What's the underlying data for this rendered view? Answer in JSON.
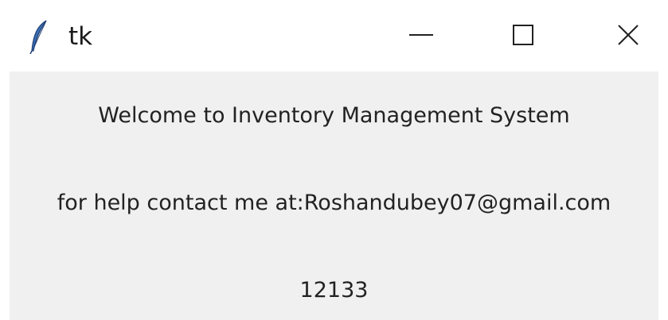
{
  "window": {
    "title": "tk",
    "app_icon": "feather-icon",
    "controls": {
      "minimize_icon": "minimize-icon",
      "maximize_icon": "maximize-icon",
      "close_icon": "close-icon"
    }
  },
  "content": {
    "welcome_text": "Welcome to Inventory Management System",
    "help_text": "for help contact me at:Roshandubey07@gmail.com",
    "number_text": "12133"
  },
  "colors": {
    "titlebar_bg": "#ffffff",
    "client_bg": "#f0f0f0",
    "text": "#222222"
  }
}
